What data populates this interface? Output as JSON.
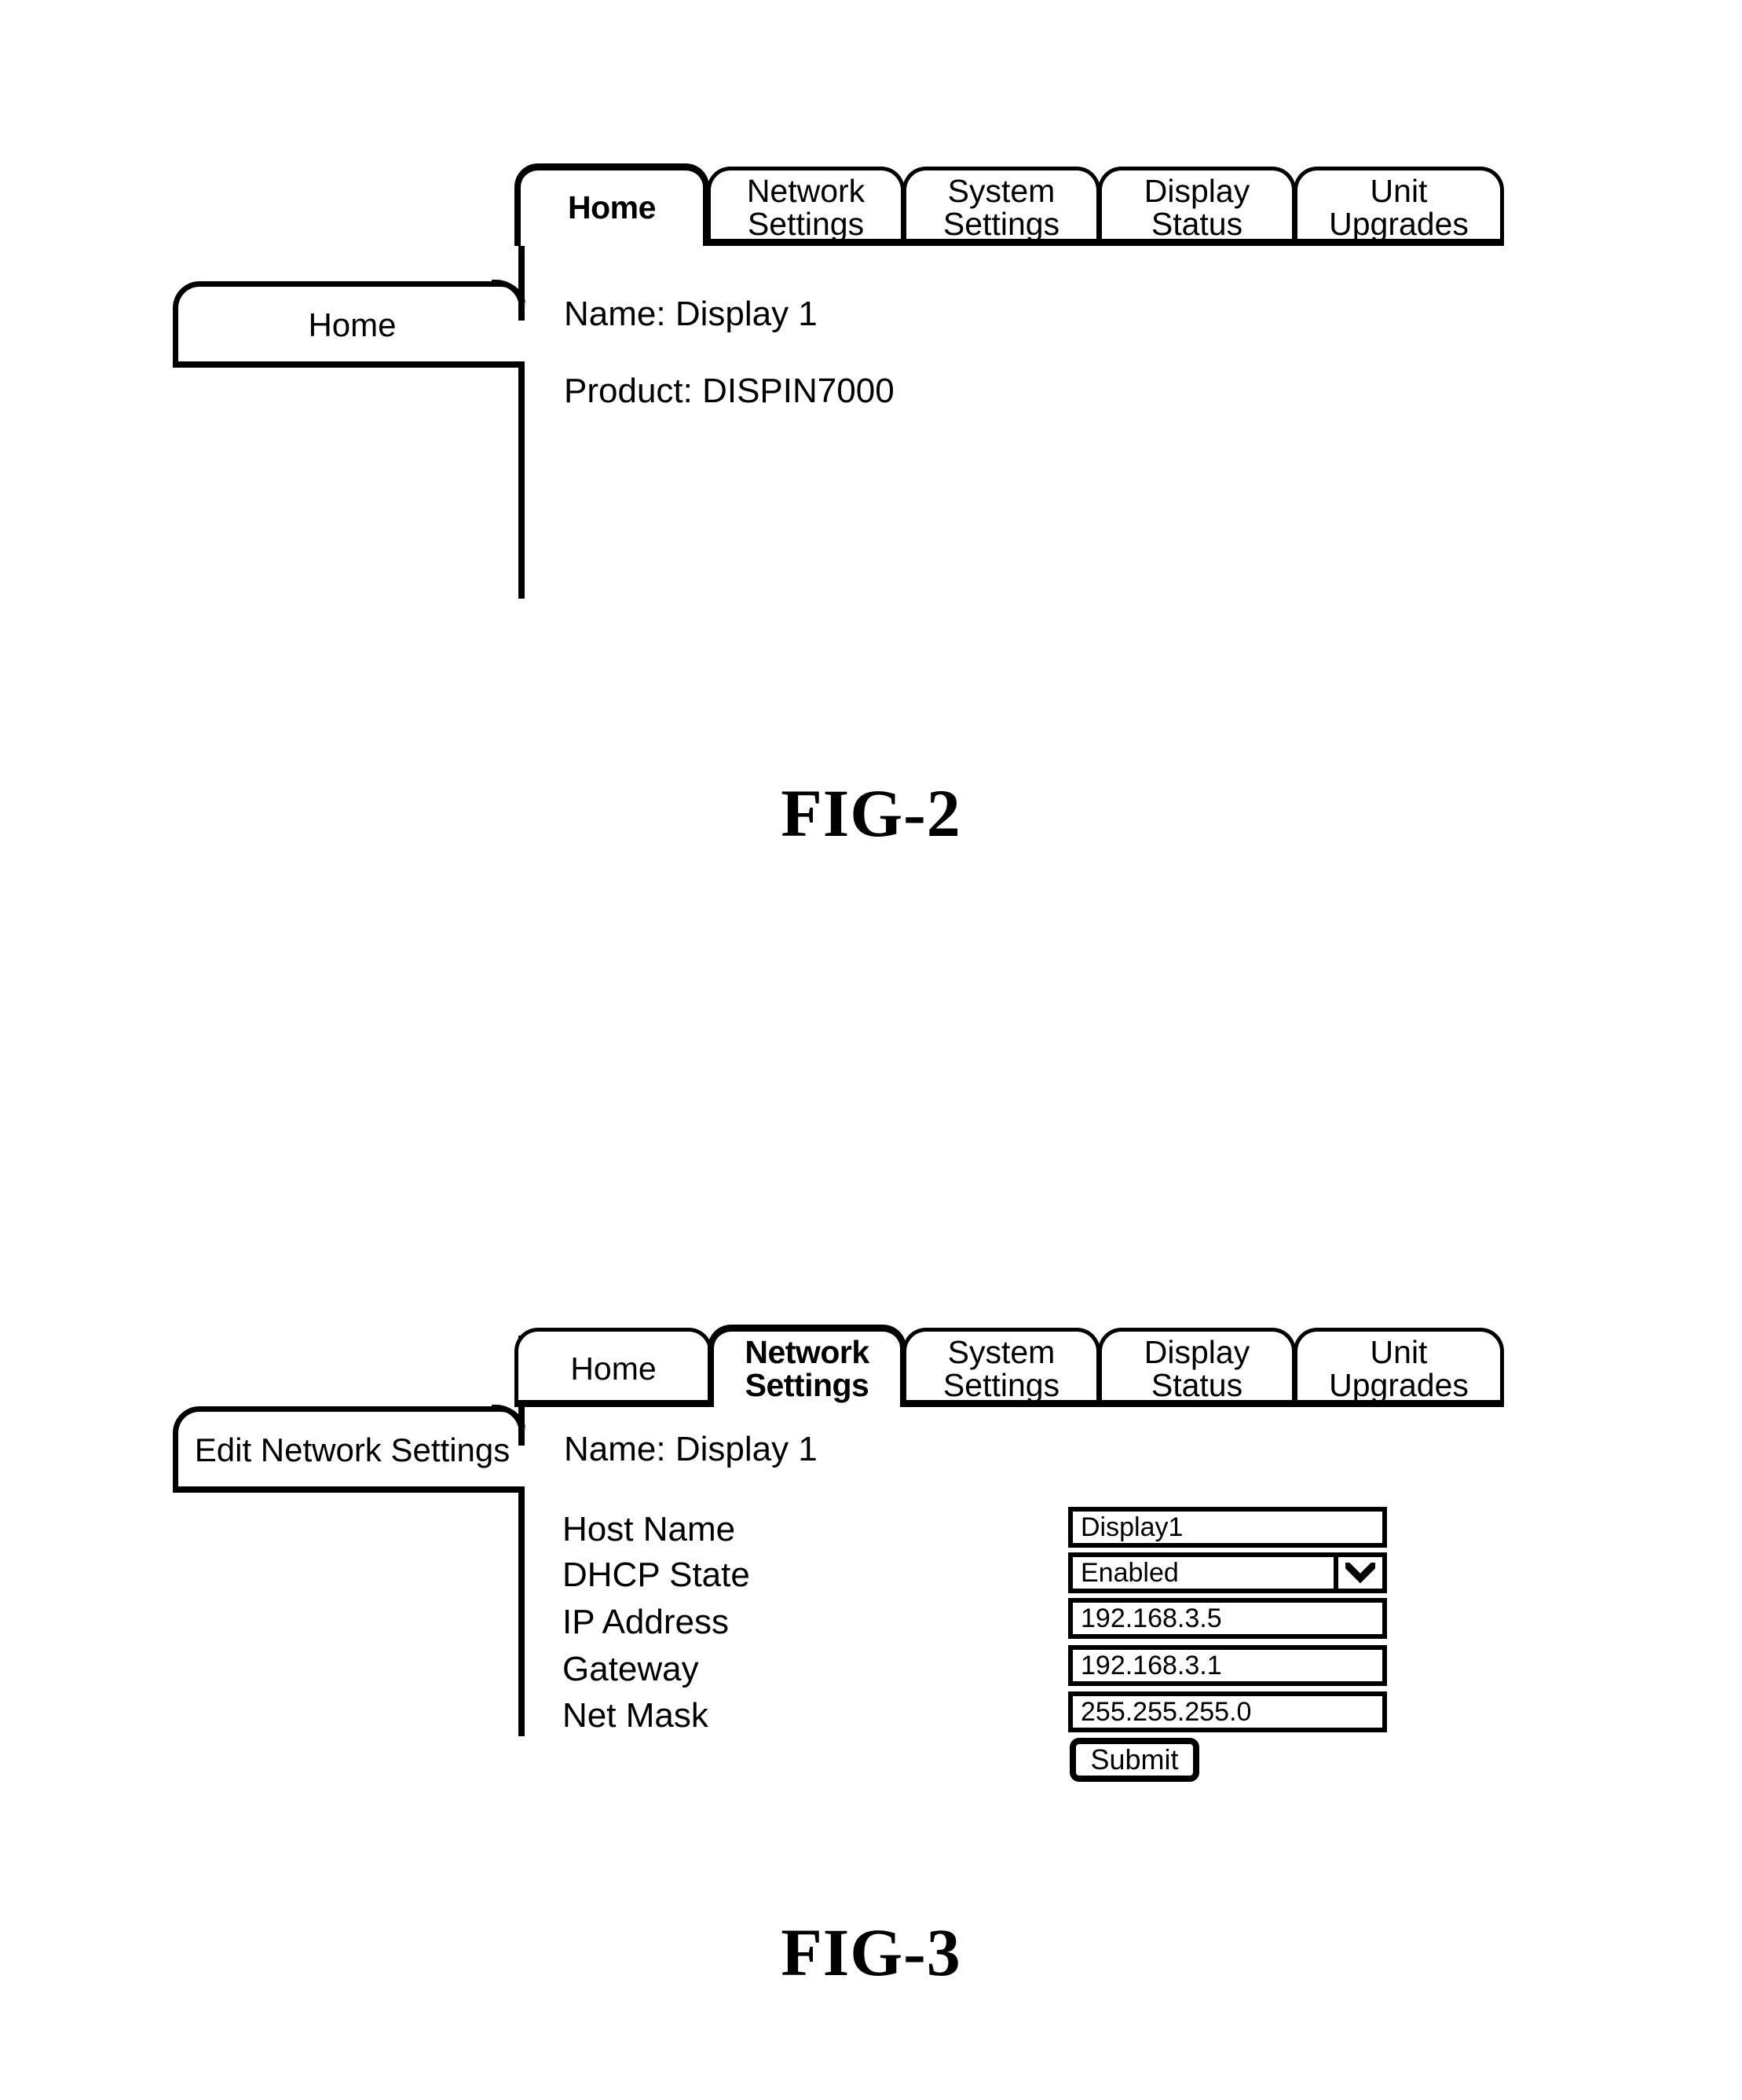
{
  "figures": [
    {
      "caption": "FIG-2",
      "side_panel": {
        "label": "Home"
      },
      "tabs": [
        {
          "label": "Home",
          "active": true
        },
        {
          "label": "Network\nSettings",
          "active": false
        },
        {
          "label": "System\nSettings",
          "active": false
        },
        {
          "label": "Display\nStatus",
          "active": false
        },
        {
          "label": "Unit\nUpgrades",
          "active": false
        }
      ],
      "content_lines": [
        {
          "text": "Name:  Display 1"
        },
        {
          "text": "Product:  DISPIN7000"
        }
      ]
    },
    {
      "caption": "FIG-3",
      "side_panel": {
        "label": "Edit Network Settings"
      },
      "tabs": [
        {
          "label": "Home",
          "active": false
        },
        {
          "label": "Network\nSettings",
          "active": true
        },
        {
          "label": "System\nSettings",
          "active": false
        },
        {
          "label": "Display\nStatus",
          "active": false
        },
        {
          "label": "Unit\nUpgrades",
          "active": false
        }
      ],
      "content_lines": [
        {
          "text": "Name:  Display 1"
        }
      ],
      "form": {
        "rows": [
          {
            "label": "Host Name",
            "value": "Display1",
            "type": "text"
          },
          {
            "label": "DHCP State",
            "value": "Enabled",
            "type": "select"
          },
          {
            "label": "IP Address",
            "value": "192.168.3.5",
            "type": "text"
          },
          {
            "label": "Gateway",
            "value": "192.168.3.1",
            "type": "text"
          },
          {
            "label": "Net Mask",
            "value": "255.255.255.0",
            "type": "text"
          }
        ],
        "submit_label": "Submit",
        "select_icon": "chevron-down-icon"
      }
    }
  ],
  "colors": {
    "ink": "#000000",
    "paper": "#ffffff"
  }
}
